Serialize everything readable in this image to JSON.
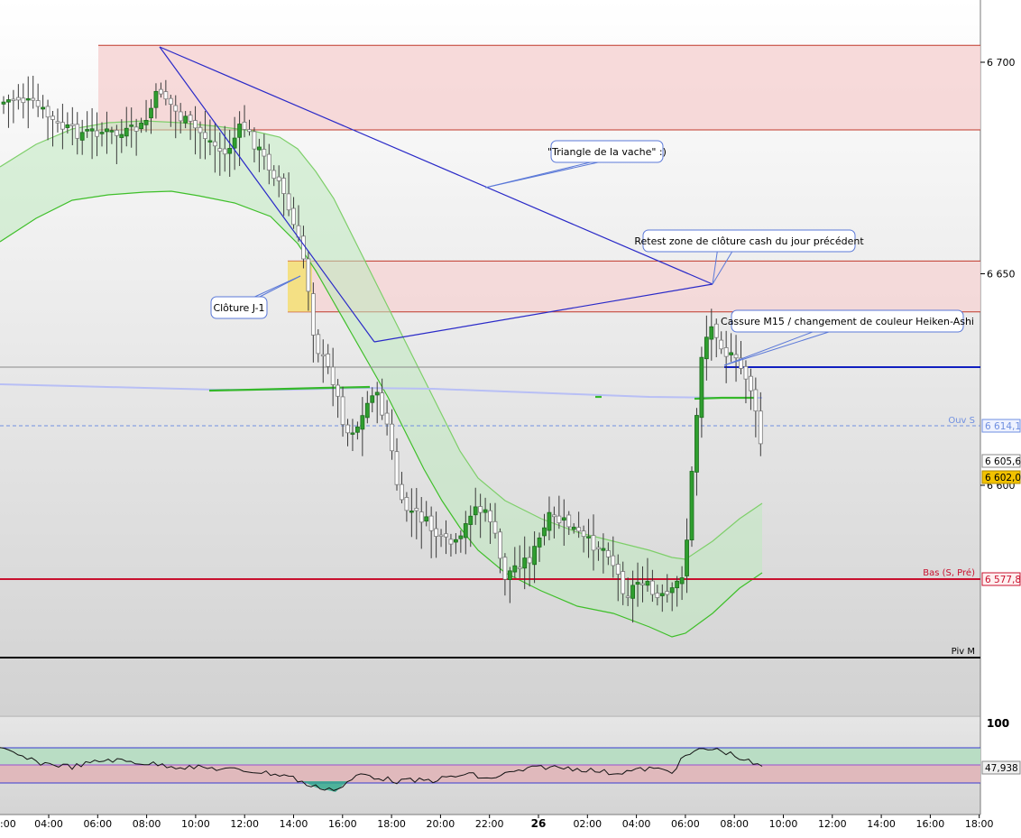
{
  "chart_data": {
    "type": "candlestick",
    "instrument_unlabeled": true,
    "price_axis": {
      "ticks": [
        "6 700",
        "6 650",
        "6 600"
      ],
      "tick_values": [
        6700,
        6650,
        6600
      ],
      "ylim": [
        6513.5,
        6714.5
      ]
    },
    "time_axis": {
      "ticks": [
        "04:00",
        "06:00",
        "08:00",
        "10:00",
        "12:00",
        "14:00",
        "16:00",
        "18:00",
        "20:00",
        "22:00",
        "26",
        "02:00",
        "04:00",
        "06:00",
        "08:00",
        "10:00",
        "12:00",
        "14:00",
        "16:00",
        "18:00"
      ],
      "first_tick_visible": ":00"
    },
    "tags": {
      "ouv_s": {
        "label": "Ouv S",
        "value": "6 614,1",
        "color": "#6f8fe0"
      },
      "last_a": {
        "value": "6 605,6"
      },
      "last_b": {
        "value": "6 602,0",
        "color": "#f2c200"
      },
      "bas": {
        "label": "Bas (S, Pré)",
        "value": "6 577,8",
        "color": "#c8102e"
      },
      "piv": {
        "label": "Piv M",
        "color": "#000000"
      }
    },
    "zones": [
      {
        "name": "upper-resistance-zone",
        "from": 6684,
        "to": 6704,
        "color": "#f6d4d4"
      },
      {
        "name": "previous-close-zone",
        "from": 6641,
        "to": 6653,
        "color": "#f4d6d6"
      }
    ],
    "annotations": {
      "triangle": "\"Triangle de la vache\" :)",
      "retest": "Retest zone de clôture cash du jour précédent",
      "cassure": "Cassure M15 / changement de couleur Heiken-Ashi",
      "cloture": "Clôture J-1"
    },
    "oscillator": {
      "top_label": "100",
      "current_value": "47,938",
      "upper_band": 70,
      "lower_band": 30
    }
  }
}
